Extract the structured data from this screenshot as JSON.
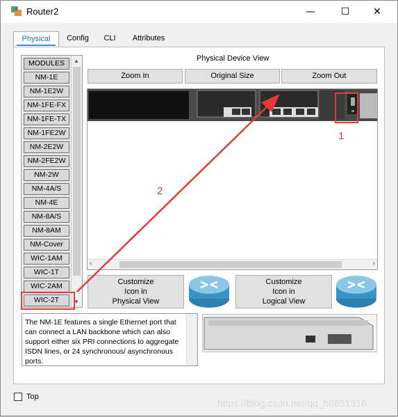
{
  "window": {
    "title": "Router2",
    "minimize": "—",
    "maximize": "☐",
    "close": "✕"
  },
  "tabs": [
    {
      "label": "Physical"
    },
    {
      "label": "Config"
    },
    {
      "label": "CLI"
    },
    {
      "label": "Attributes"
    }
  ],
  "modules": {
    "header": "MODULES",
    "items": [
      "NM-1E",
      "NM-1E2W",
      "NM-1FE-FX",
      "NM-1FE-TX",
      "NM-1FE2W",
      "NM-2E2W",
      "NM-2FE2W",
      "NM-2W",
      "NM-4A/S",
      "NM-4E",
      "NM-8A/S",
      "NM-8AM",
      "NM-Cover",
      "WIC-1AM",
      "WIC-1T",
      "WIC-2AM",
      "WIC-2T"
    ]
  },
  "device_view": {
    "label": "Physical Device View",
    "zoom_in": "Zoom In",
    "original_size": "Original Size",
    "zoom_out": "Zoom Out"
  },
  "customize": {
    "physical": [
      "Customize",
      "Icon in",
      "Physical View"
    ],
    "logical": [
      "Customize",
      "Icon in",
      "Logical View"
    ]
  },
  "description": "The NM-1E features a single Ethernet port that can connect a LAN backbone which can also support either six PRI connections to aggregate ISDN lines, or 24 synchronous/ asynchronous ports.",
  "footer": {
    "top_label": "Top"
  },
  "annotations": {
    "label_1": "1",
    "label_2": "2",
    "color": "#e53935"
  },
  "watermark": "https://blog.csdn.net/qq_50851316"
}
